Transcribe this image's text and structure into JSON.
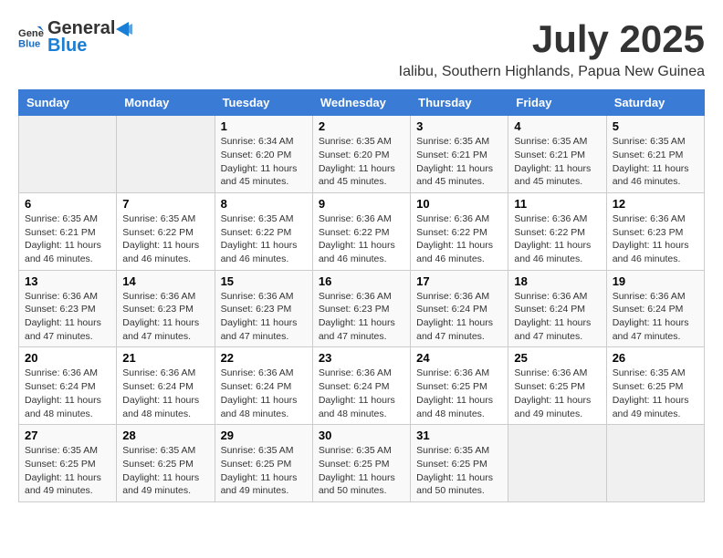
{
  "header": {
    "logo_general": "General",
    "logo_blue": "Blue",
    "title": "July 2025",
    "subtitle": "Ialibu, Southern Highlands, Papua New Guinea"
  },
  "calendar": {
    "weekdays": [
      "Sunday",
      "Monday",
      "Tuesday",
      "Wednesday",
      "Thursday",
      "Friday",
      "Saturday"
    ],
    "weeks": [
      [
        {
          "day": "",
          "info": ""
        },
        {
          "day": "",
          "info": ""
        },
        {
          "day": "1",
          "info": "Sunrise: 6:34 AM\nSunset: 6:20 PM\nDaylight: 11 hours and 45 minutes."
        },
        {
          "day": "2",
          "info": "Sunrise: 6:35 AM\nSunset: 6:20 PM\nDaylight: 11 hours and 45 minutes."
        },
        {
          "day": "3",
          "info": "Sunrise: 6:35 AM\nSunset: 6:21 PM\nDaylight: 11 hours and 45 minutes."
        },
        {
          "day": "4",
          "info": "Sunrise: 6:35 AM\nSunset: 6:21 PM\nDaylight: 11 hours and 45 minutes."
        },
        {
          "day": "5",
          "info": "Sunrise: 6:35 AM\nSunset: 6:21 PM\nDaylight: 11 hours and 46 minutes."
        }
      ],
      [
        {
          "day": "6",
          "info": "Sunrise: 6:35 AM\nSunset: 6:21 PM\nDaylight: 11 hours and 46 minutes."
        },
        {
          "day": "7",
          "info": "Sunrise: 6:35 AM\nSunset: 6:22 PM\nDaylight: 11 hours and 46 minutes."
        },
        {
          "day": "8",
          "info": "Sunrise: 6:35 AM\nSunset: 6:22 PM\nDaylight: 11 hours and 46 minutes."
        },
        {
          "day": "9",
          "info": "Sunrise: 6:36 AM\nSunset: 6:22 PM\nDaylight: 11 hours and 46 minutes."
        },
        {
          "day": "10",
          "info": "Sunrise: 6:36 AM\nSunset: 6:22 PM\nDaylight: 11 hours and 46 minutes."
        },
        {
          "day": "11",
          "info": "Sunrise: 6:36 AM\nSunset: 6:22 PM\nDaylight: 11 hours and 46 minutes."
        },
        {
          "day": "12",
          "info": "Sunrise: 6:36 AM\nSunset: 6:23 PM\nDaylight: 11 hours and 46 minutes."
        }
      ],
      [
        {
          "day": "13",
          "info": "Sunrise: 6:36 AM\nSunset: 6:23 PM\nDaylight: 11 hours and 47 minutes."
        },
        {
          "day": "14",
          "info": "Sunrise: 6:36 AM\nSunset: 6:23 PM\nDaylight: 11 hours and 47 minutes."
        },
        {
          "day": "15",
          "info": "Sunrise: 6:36 AM\nSunset: 6:23 PM\nDaylight: 11 hours and 47 minutes."
        },
        {
          "day": "16",
          "info": "Sunrise: 6:36 AM\nSunset: 6:23 PM\nDaylight: 11 hours and 47 minutes."
        },
        {
          "day": "17",
          "info": "Sunrise: 6:36 AM\nSunset: 6:24 PM\nDaylight: 11 hours and 47 minutes."
        },
        {
          "day": "18",
          "info": "Sunrise: 6:36 AM\nSunset: 6:24 PM\nDaylight: 11 hours and 47 minutes."
        },
        {
          "day": "19",
          "info": "Sunrise: 6:36 AM\nSunset: 6:24 PM\nDaylight: 11 hours and 47 minutes."
        }
      ],
      [
        {
          "day": "20",
          "info": "Sunrise: 6:36 AM\nSunset: 6:24 PM\nDaylight: 11 hours and 48 minutes."
        },
        {
          "day": "21",
          "info": "Sunrise: 6:36 AM\nSunset: 6:24 PM\nDaylight: 11 hours and 48 minutes."
        },
        {
          "day": "22",
          "info": "Sunrise: 6:36 AM\nSunset: 6:24 PM\nDaylight: 11 hours and 48 minutes."
        },
        {
          "day": "23",
          "info": "Sunrise: 6:36 AM\nSunset: 6:24 PM\nDaylight: 11 hours and 48 minutes."
        },
        {
          "day": "24",
          "info": "Sunrise: 6:36 AM\nSunset: 6:25 PM\nDaylight: 11 hours and 48 minutes."
        },
        {
          "day": "25",
          "info": "Sunrise: 6:36 AM\nSunset: 6:25 PM\nDaylight: 11 hours and 49 minutes."
        },
        {
          "day": "26",
          "info": "Sunrise: 6:35 AM\nSunset: 6:25 PM\nDaylight: 11 hours and 49 minutes."
        }
      ],
      [
        {
          "day": "27",
          "info": "Sunrise: 6:35 AM\nSunset: 6:25 PM\nDaylight: 11 hours and 49 minutes."
        },
        {
          "day": "28",
          "info": "Sunrise: 6:35 AM\nSunset: 6:25 PM\nDaylight: 11 hours and 49 minutes."
        },
        {
          "day": "29",
          "info": "Sunrise: 6:35 AM\nSunset: 6:25 PM\nDaylight: 11 hours and 49 minutes."
        },
        {
          "day": "30",
          "info": "Sunrise: 6:35 AM\nSunset: 6:25 PM\nDaylight: 11 hours and 50 minutes."
        },
        {
          "day": "31",
          "info": "Sunrise: 6:35 AM\nSunset: 6:25 PM\nDaylight: 11 hours and 50 minutes."
        },
        {
          "day": "",
          "info": ""
        },
        {
          "day": "",
          "info": ""
        }
      ]
    ]
  }
}
